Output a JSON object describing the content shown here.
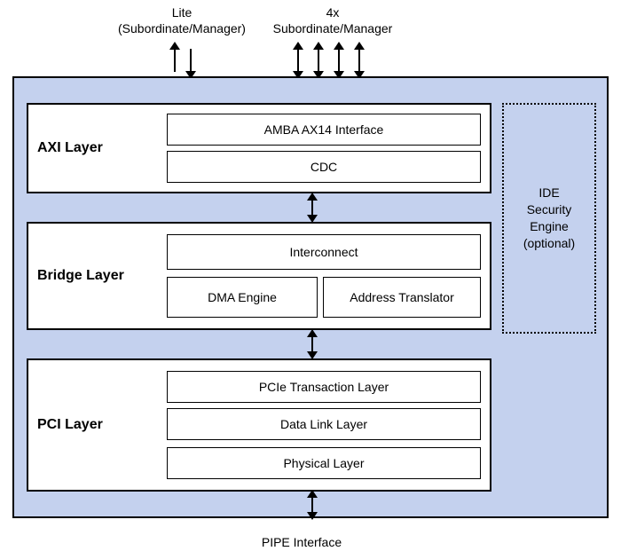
{
  "labels": {
    "lite": "Lite\n(Subordinate/Manager)",
    "x4": "4x\nSubordinate/Manager",
    "pipe": "PIPE Interface"
  },
  "layers": {
    "axi": {
      "title": "AXI Layer",
      "amba": "AMBA AX14 Interface",
      "cdc": "CDC"
    },
    "bridge": {
      "title": "Bridge Layer",
      "interconnect": "Interconnect",
      "dma": "DMA Engine",
      "addr": "Address Translator"
    },
    "pci": {
      "title": "PCI Layer",
      "tl": "PCIe Transaction Layer",
      "dll": "Data Link Layer",
      "phy": "Physical Layer"
    }
  },
  "ide": "IDE\nSecurity\nEngine\n(optional)"
}
